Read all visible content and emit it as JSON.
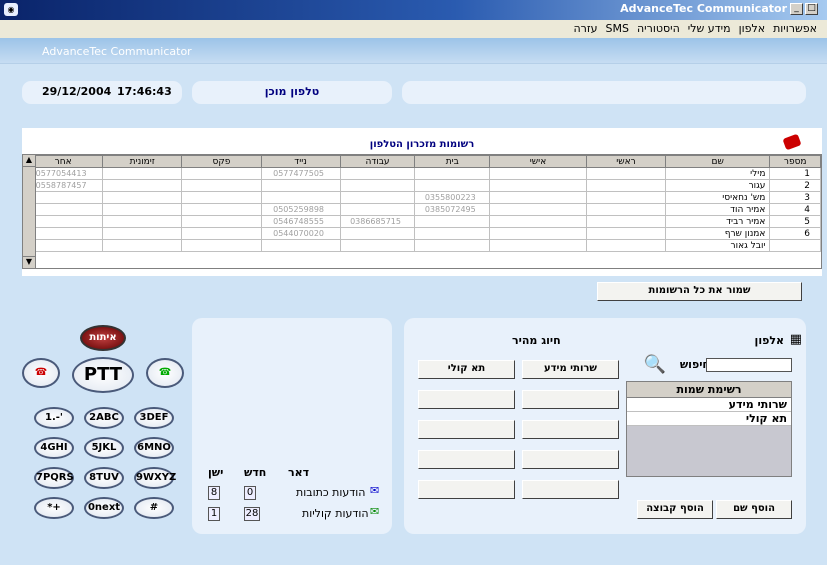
{
  "window": {
    "title": "AdvanceTec Communicator",
    "icon": "app-icon"
  },
  "menu": [
    "אפשרויות",
    "אלפון",
    "מידע שלי",
    "היסטוריה",
    "SMS",
    "עזרה"
  ],
  "banner": {
    "app_name": "AdvanceTec Communicator"
  },
  "status": {
    "date": "29/12/2004",
    "time": "17:46:43",
    "phone_status": "טלפון מוכן"
  },
  "contacts": {
    "title": "רשומות מזכרון הטלפון",
    "columns": [
      "מספר",
      "שם",
      "ראשי",
      "אישי",
      "בית",
      "עבודה",
      "נייד",
      "פקס",
      "זימונית",
      "אחר"
    ],
    "rows": [
      [
        "1",
        "מילי",
        "",
        "",
        "",
        "",
        "0577477505",
        "",
        "",
        "0577054413"
      ],
      [
        "2",
        "עגור",
        "",
        "",
        "",
        "",
        "",
        "",
        "",
        "0558787457"
      ],
      [
        "3",
        "מש' נחאיסי",
        "",
        "",
        "0355800223",
        "",
        "",
        "",
        "",
        ""
      ],
      [
        "4",
        "אמיר הוד",
        "",
        "",
        "0385072495",
        "",
        "0505259898",
        "",
        "",
        ""
      ],
      [
        "5",
        "אמיר רביד",
        "",
        "",
        "",
        "0386685715",
        "0546748555",
        "",
        "",
        ""
      ],
      [
        "6",
        "אמנון שרף",
        "",
        "",
        "",
        "",
        "0544070020",
        "",
        "",
        ""
      ]
    ],
    "partial_row": "יובל גאור",
    "save_all": "שמור את כל הרשומות"
  },
  "keypad": {
    "top": "איתות",
    "ptt": "PTT",
    "keys": [
      [
        "1.-'",
        "2ABC",
        "3DEF"
      ],
      [
        "4GHI",
        "5JKL",
        "6MNO"
      ],
      [
        "7PQRS",
        "8TUV",
        "9WXYZ"
      ],
      [
        "*+",
        "0next",
        "#"
      ]
    ]
  },
  "mail": {
    "header": "דאר",
    "new": "חדש",
    "old": "ישן",
    "messages": [
      {
        "label": "הודעות כתובות",
        "new": "0",
        "old": "8"
      },
      {
        "label": "הודעות קוליות",
        "new": "28",
        "old": "1"
      }
    ]
  },
  "phonebook": {
    "title": "אלפון",
    "search_label": "חיפוש",
    "search_value": "",
    "list_header": "רשימת שמות",
    "list": [
      "שרותי מידע",
      "תא קולי"
    ],
    "add_name": "הוסף שם",
    "add_group": "הוסף קבוצה"
  },
  "speed_dial": {
    "title": "חיוג מהיר",
    "buttons": [
      "שרותי מידע",
      "תא קולי",
      "",
      "",
      "",
      "",
      "",
      "",
      "",
      ""
    ]
  }
}
